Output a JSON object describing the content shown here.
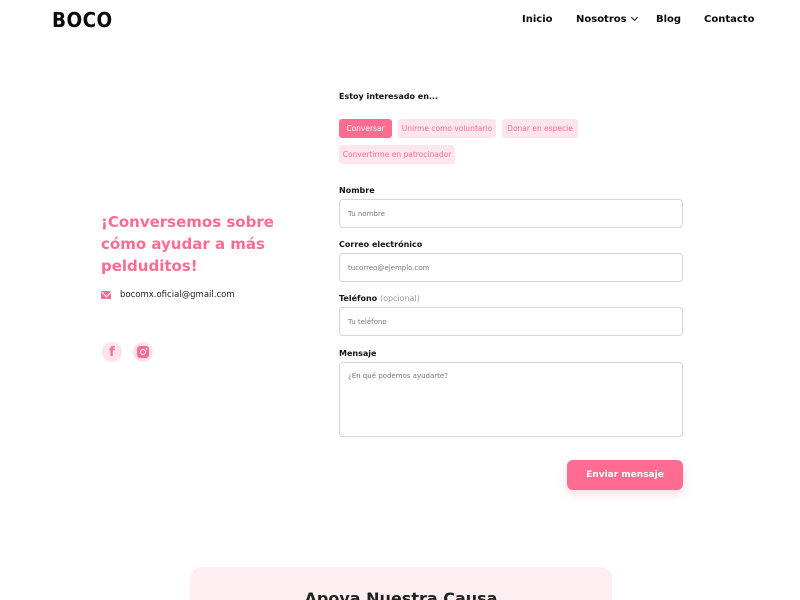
{
  "header": {
    "logo": "BOCO",
    "nav": [
      {
        "label": "Inicio"
      },
      {
        "label": "Nosotros"
      },
      {
        "label": "Blog"
      },
      {
        "label": "Contacto"
      }
    ]
  },
  "contact": {
    "headline": "¡Conversemos sobre cómo ayudar a más pelduditos!",
    "email": "bocomx.oficial@gmail.com",
    "social_icons": [
      "facebook-icon",
      "instagram-icon"
    ]
  },
  "form": {
    "interest_label": "Estoy interesado en...",
    "interest_options": [
      {
        "label": "Conversar",
        "selected": true
      },
      {
        "label": "Unirme como voluntario",
        "selected": false
      },
      {
        "label": "Donar en especie",
        "selected": false
      },
      {
        "label": "Convertirme en patrocinador",
        "selected": false
      }
    ],
    "name_label": "Nombre",
    "name_placeholder": "Tu nombre",
    "email_label": "Correo electrónico",
    "email_placeholder": "tucorreo@ejemplo.com",
    "phone_label": "Teléfono",
    "phone_optional": "(opcional)",
    "phone_placeholder": "Tu teléfono",
    "message_label": "Mensaje",
    "message_placeholder": "¿En qué podemos ayudarte?",
    "submit_label": "Enviar mensaje"
  },
  "cause": {
    "title": "Apoya Nuestra Causa"
  },
  "colors": {
    "accent": "#ff6b91",
    "chip_bg": "#ffe6ec",
    "card_bg": "#fdeef2"
  }
}
